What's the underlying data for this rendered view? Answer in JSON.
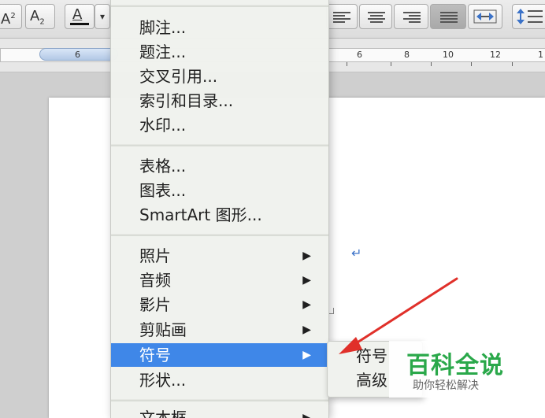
{
  "toolbar": {
    "superscript_label": "A",
    "superscript_mark": "2",
    "subscript_label": "A",
    "subscript_mark": "2",
    "font_color_label": "A",
    "dropdown_glyph": "▾"
  },
  "ruler": {
    "numbers": [
      "6",
      "6",
      "8",
      "10",
      "12",
      "1"
    ]
  },
  "document": {
    "paragraph_mark": "↵"
  },
  "menu": {
    "items": [
      {
        "label": "脚注...",
        "has_submenu": false
      },
      {
        "label": "题注...",
        "has_submenu": false
      },
      {
        "label": "交叉引用...",
        "has_submenu": false
      },
      {
        "label": "索引和目录...",
        "has_submenu": false
      },
      {
        "label": "水印...",
        "has_submenu": false
      },
      {
        "label": "表格...",
        "has_submenu": false
      },
      {
        "label": "图表...",
        "has_submenu": false
      },
      {
        "label": "SmartArt 图形...",
        "has_submenu": false
      },
      {
        "label": "照片",
        "has_submenu": true
      },
      {
        "label": "音频",
        "has_submenu": true
      },
      {
        "label": "影片",
        "has_submenu": true
      },
      {
        "label": "剪贴画",
        "has_submenu": true
      },
      {
        "label": "符号",
        "has_submenu": true,
        "highlighted": true
      },
      {
        "label": "形状...",
        "has_submenu": false
      },
      {
        "label": "文本框",
        "has_submenu": true
      }
    ],
    "submenu_arrow": "▶",
    "highlight_color": "#3f87e8"
  },
  "submenu": {
    "items": [
      "符号",
      "高级"
    ]
  },
  "watermark": {
    "title": "百科全说",
    "subtitle": "助你轻松解决",
    "color": "#2aa84a"
  },
  "annotation": {
    "arrow_color": "#e0302a"
  }
}
